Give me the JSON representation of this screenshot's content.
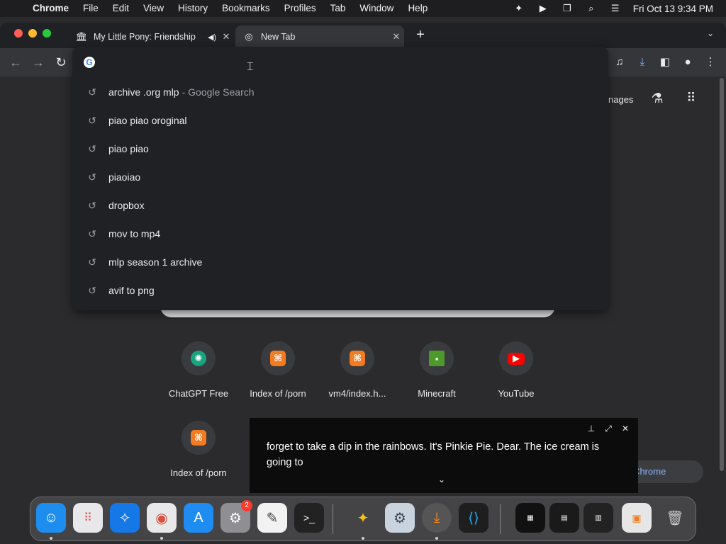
{
  "menubar": {
    "app_name": "Chrome",
    "items": [
      "File",
      "Edit",
      "View",
      "History",
      "Bookmarks",
      "Profiles",
      "Tab",
      "Window",
      "Help"
    ],
    "clock": "Fri Oct 13  9:34 PM"
  },
  "tabs": [
    {
      "title": "My Little Pony: Friendship",
      "favicon": "museum-icon",
      "audio": true
    },
    {
      "title": "New Tab",
      "favicon": "chrome-icon",
      "active": true
    }
  ],
  "omnibox": {
    "value": "",
    "suggestions": [
      {
        "text": "archive .org mlp",
        "suffix": "- Google Search"
      },
      {
        "text": "piao piao oroginal",
        "suffix": ""
      },
      {
        "text": "piao piao",
        "suffix": ""
      },
      {
        "text": "piaoiao",
        "suffix": ""
      },
      {
        "text": "dropbox",
        "suffix": ""
      },
      {
        "text": "mov to mp4",
        "suffix": ""
      },
      {
        "text": "mlp season 1 archive",
        "suffix": ""
      },
      {
        "text": "avif to png",
        "suffix": ""
      }
    ]
  },
  "ntp": {
    "images_link": "nages",
    "shortcuts": [
      {
        "label": "ChatGPT Free",
        "icon": "chatgpt-icon",
        "glyph": "✺"
      },
      {
        "label": "Index of /porn",
        "icon": "xampp-icon",
        "glyph": "⌘"
      },
      {
        "label": "vm4/index.h...",
        "icon": "xampp-icon",
        "glyph": "⌘"
      },
      {
        "label": "Minecraft",
        "icon": "minecraft-icon",
        "glyph": "▪"
      },
      {
        "label": "YouTube",
        "icon": "youtube-icon",
        "glyph": "▶"
      },
      {
        "label": "Index of /porn",
        "icon": "xampp-icon",
        "glyph": "⌘"
      }
    ],
    "customize_label": "mize Chrome"
  },
  "live_caption": {
    "text": "forget to take a dip in the rainbows. It's Pinkie Pie. Dear. The ice cream is going to"
  },
  "dock": {
    "settings_badge": "2"
  },
  "colors": {
    "accent": "#8ab4f8",
    "page_bg": "#2b2b2e",
    "dropdown_bg": "#202124"
  }
}
